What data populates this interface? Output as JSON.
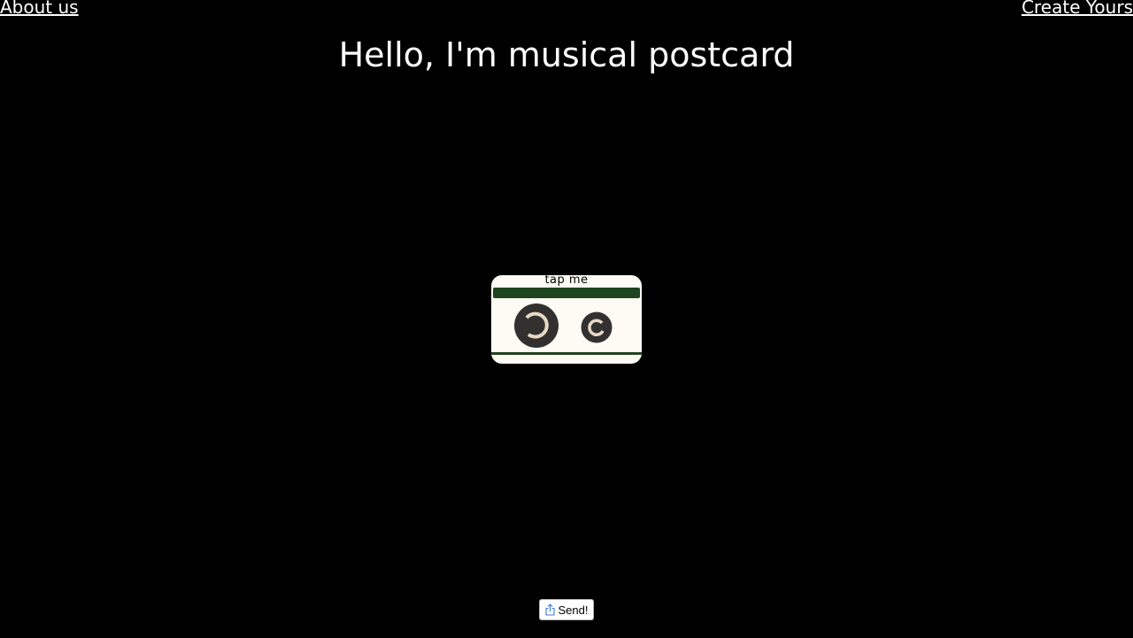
{
  "nav": {
    "about_label": "About us",
    "create_label": "Create Yours"
  },
  "header": {
    "title": "Hello, I'm musical postcard"
  },
  "cassette": {
    "tap_label": "tap me",
    "tape_color": "#1f4420",
    "body_color": "#fdfbf4",
    "reel_color": "#333130",
    "reel_ring_color": "#e8d9c7"
  },
  "send_button": {
    "label": "Send!",
    "icon": "share-icon"
  }
}
